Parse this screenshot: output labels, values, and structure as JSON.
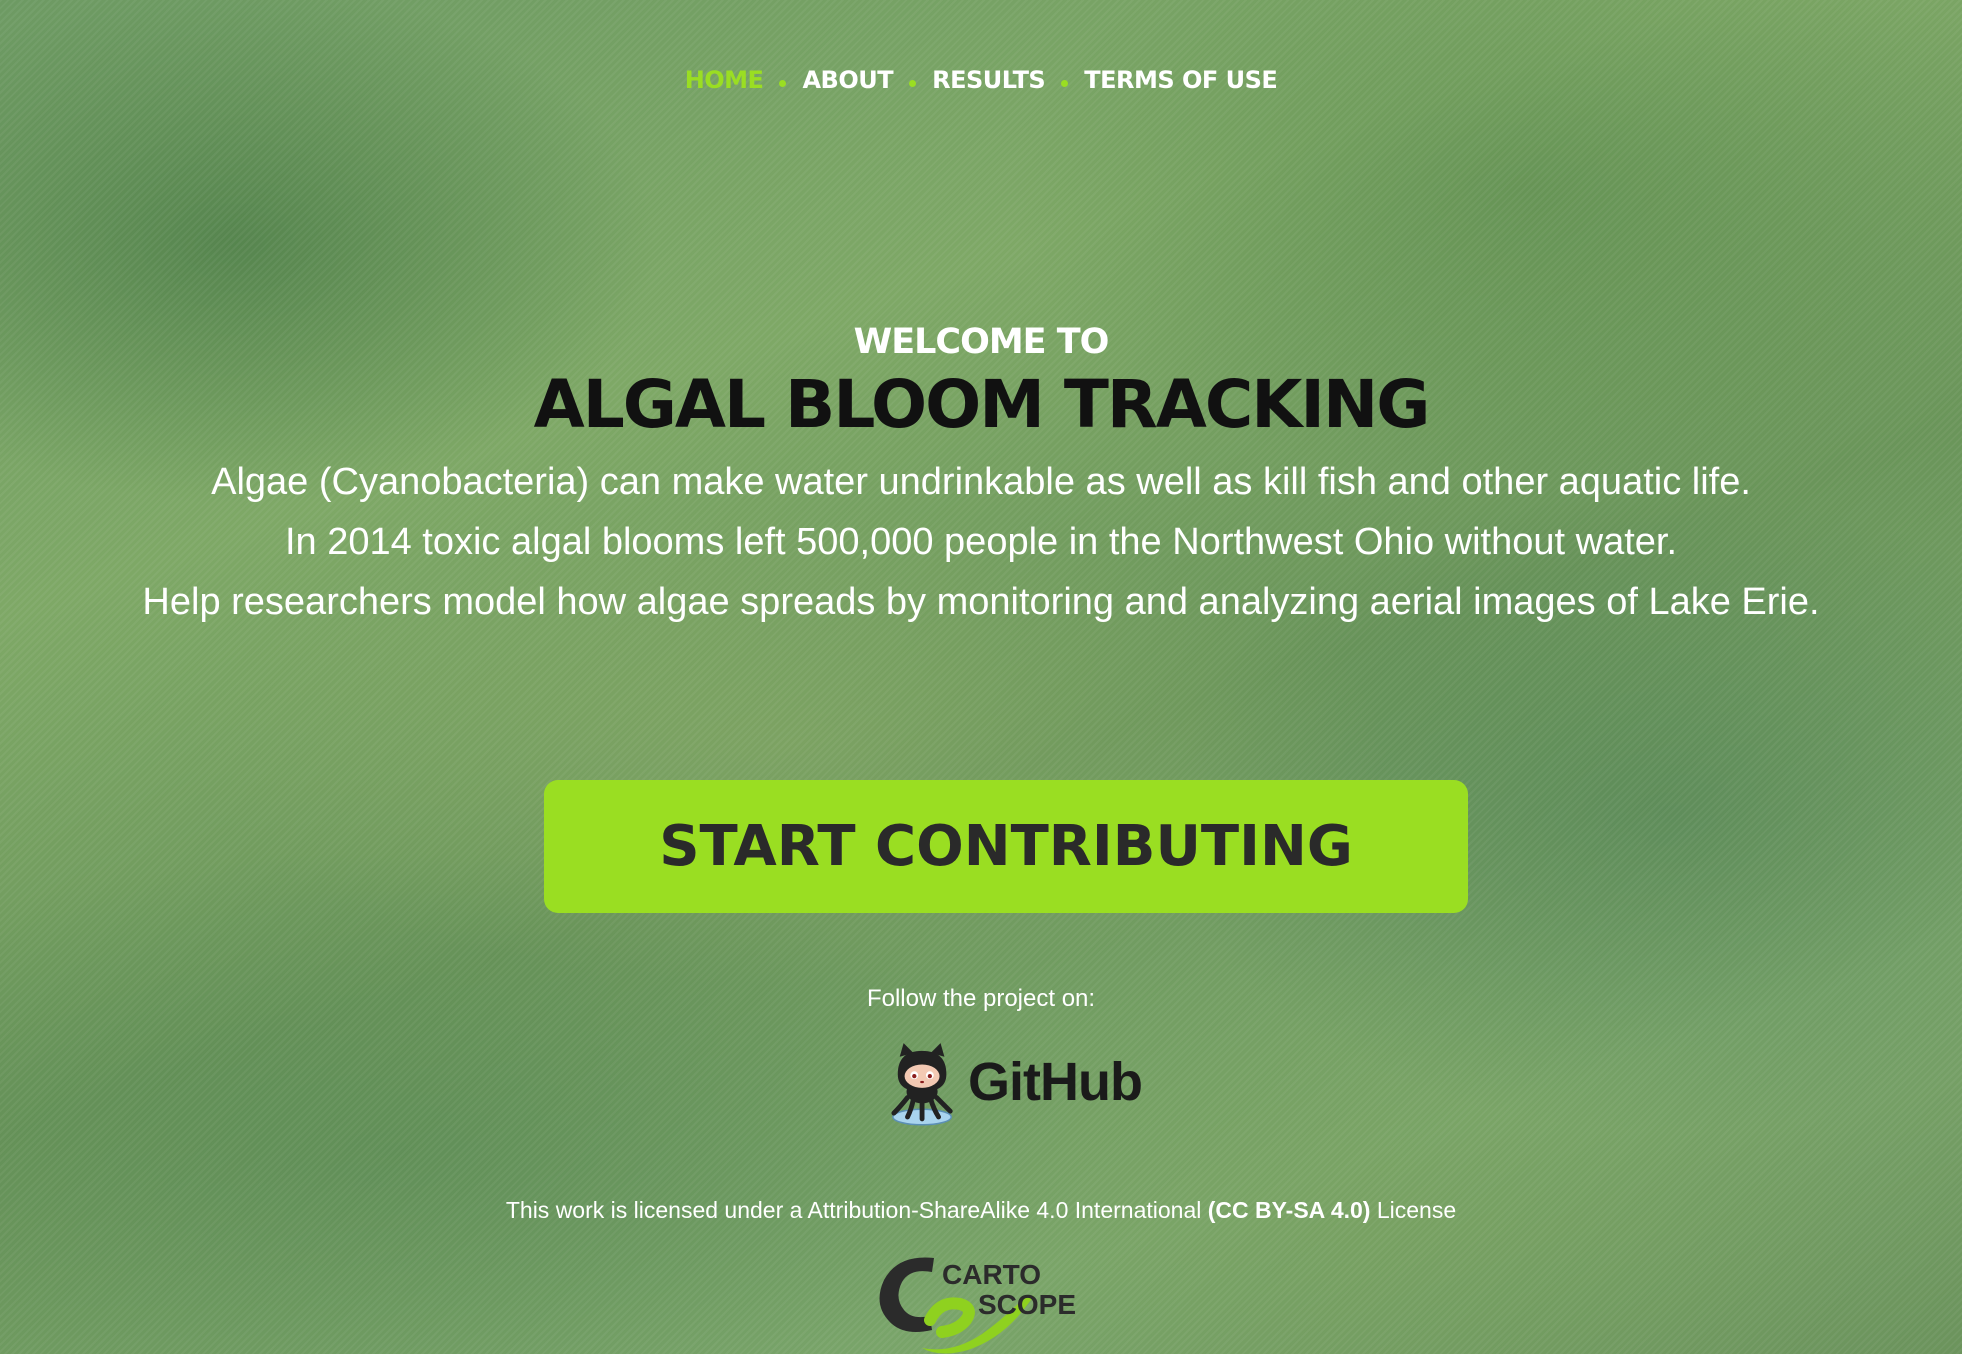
{
  "nav": {
    "items": [
      {
        "label": "HOME",
        "active": true
      },
      {
        "label": "ABOUT",
        "active": false
      },
      {
        "label": "RESULTS",
        "active": false
      },
      {
        "label": "TERMS OF USE",
        "active": false
      }
    ],
    "separator_icon": "dot-icon"
  },
  "hero": {
    "welcome": "WELCOME TO",
    "title": "ALGAL BLOOM TRACKING",
    "description": [
      "Algae (Cyanobacteria) can make water undrinkable as well as kill fish and other aquatic life.",
      "In 2014 toxic algal blooms left 500,000 people in the Northwest Ohio without water.",
      "Help researchers model how algae spreads by monitoring and analyzing aerial images of Lake Erie."
    ]
  },
  "cta": {
    "label": "START CONTRIBUTING"
  },
  "follow": {
    "label": "Follow the project on:",
    "github_label": "GitHub",
    "github_icon": "octocat-icon"
  },
  "license": {
    "prefix": "This work is licensed under a Attribution-ShareAlike 4.0 International",
    "link": "(CC BY-SA 4.0)",
    "suffix": "License"
  },
  "logo": {
    "line1": "CARTO",
    "line2": "SCOPE",
    "icon": "cartoscope-logo-icon"
  },
  "colors": {
    "accent": "#9ade22",
    "title": "#111111",
    "button_text": "#2a2a2a",
    "background": "#6f9a5a"
  }
}
